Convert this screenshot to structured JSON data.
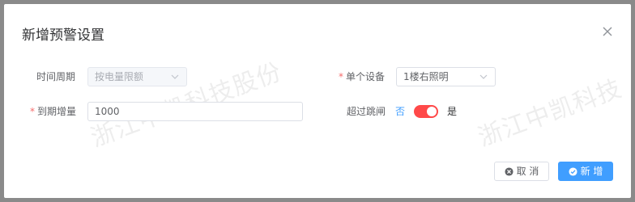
{
  "dialog": {
    "title": "新增预警设置",
    "watermark": "浙江中凯科技股份",
    "watermark_right": "浙江中凯科技"
  },
  "form": {
    "period_label": "时间周期",
    "period_value": "按电量限额",
    "device_required_mark": "*",
    "device_label": "单个设备",
    "device_value": "1楼右照明",
    "increment_required_mark": "*",
    "increment_label": "到期增量",
    "increment_value": "1000",
    "exceed_label": "超过跳闸",
    "exceed_no": "否",
    "exceed_yes": "是",
    "exceed_on": true
  },
  "buttons": {
    "cancel_label": "取 消",
    "add_label": "新 增"
  },
  "colors": {
    "primary": "#409eff",
    "switch_on": "#ff4949",
    "required": "#f56c6c"
  },
  "icons": {
    "close": "close-icon",
    "chevron": "chevron-down-icon",
    "cancel": "x-circle-icon",
    "add": "check-circle-icon"
  }
}
